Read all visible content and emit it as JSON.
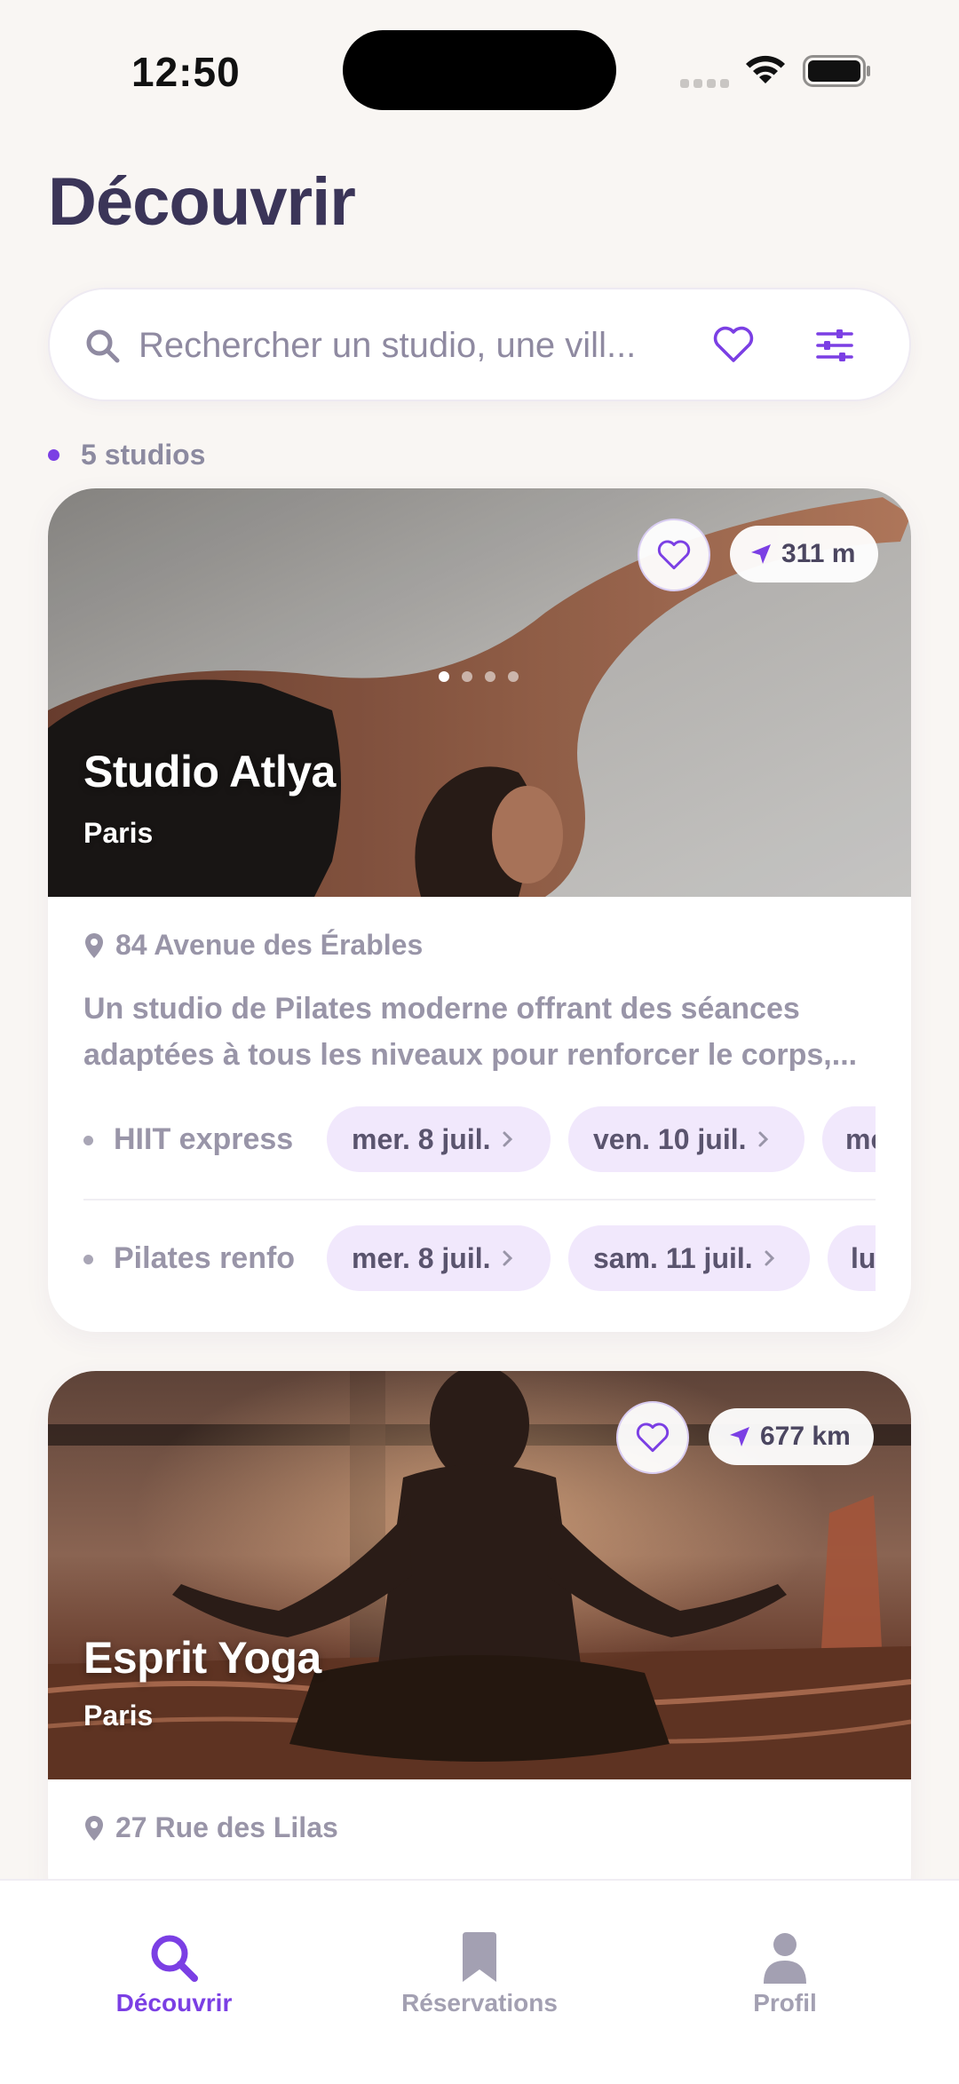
{
  "status_bar": {
    "time": "12:50"
  },
  "header": {
    "title": "Découvrir"
  },
  "search": {
    "placeholder": "Rechercher un studio, une vill..."
  },
  "results": {
    "count_label": "5 studios"
  },
  "colors": {
    "accent": "#7b3fe4",
    "chip_bg": "#f1e8fc",
    "title": "#3b3558"
  },
  "studios": [
    {
      "name": "Studio Atlya",
      "city": "Paris",
      "distance": "311 m",
      "address": "84 Avenue des Érables",
      "description_line1": "Un studio de Pilates moderne offrant des séances",
      "description_line2": "adaptées à tous les niveaux pour renforcer le corps,...",
      "sessions": [
        {
          "name": "HIIT express",
          "dates": [
            "mer. 8 juil.",
            "ven. 10 juil.",
            "me"
          ]
        },
        {
          "name": "Pilates renfo",
          "dates": [
            "mer. 8 juil.",
            "sam. 11 juil.",
            "lu"
          ]
        }
      ]
    },
    {
      "name": "Esprit Yoga",
      "city": "Paris",
      "distance": "677 km",
      "address": "27 Rue des Lilas"
    }
  ],
  "tabs": [
    {
      "label": "Découvrir",
      "icon": "search-icon",
      "active": true
    },
    {
      "label": "Réservations",
      "icon": "bookmark-icon",
      "active": false
    },
    {
      "label": "Profil",
      "icon": "person-icon",
      "active": false
    }
  ]
}
